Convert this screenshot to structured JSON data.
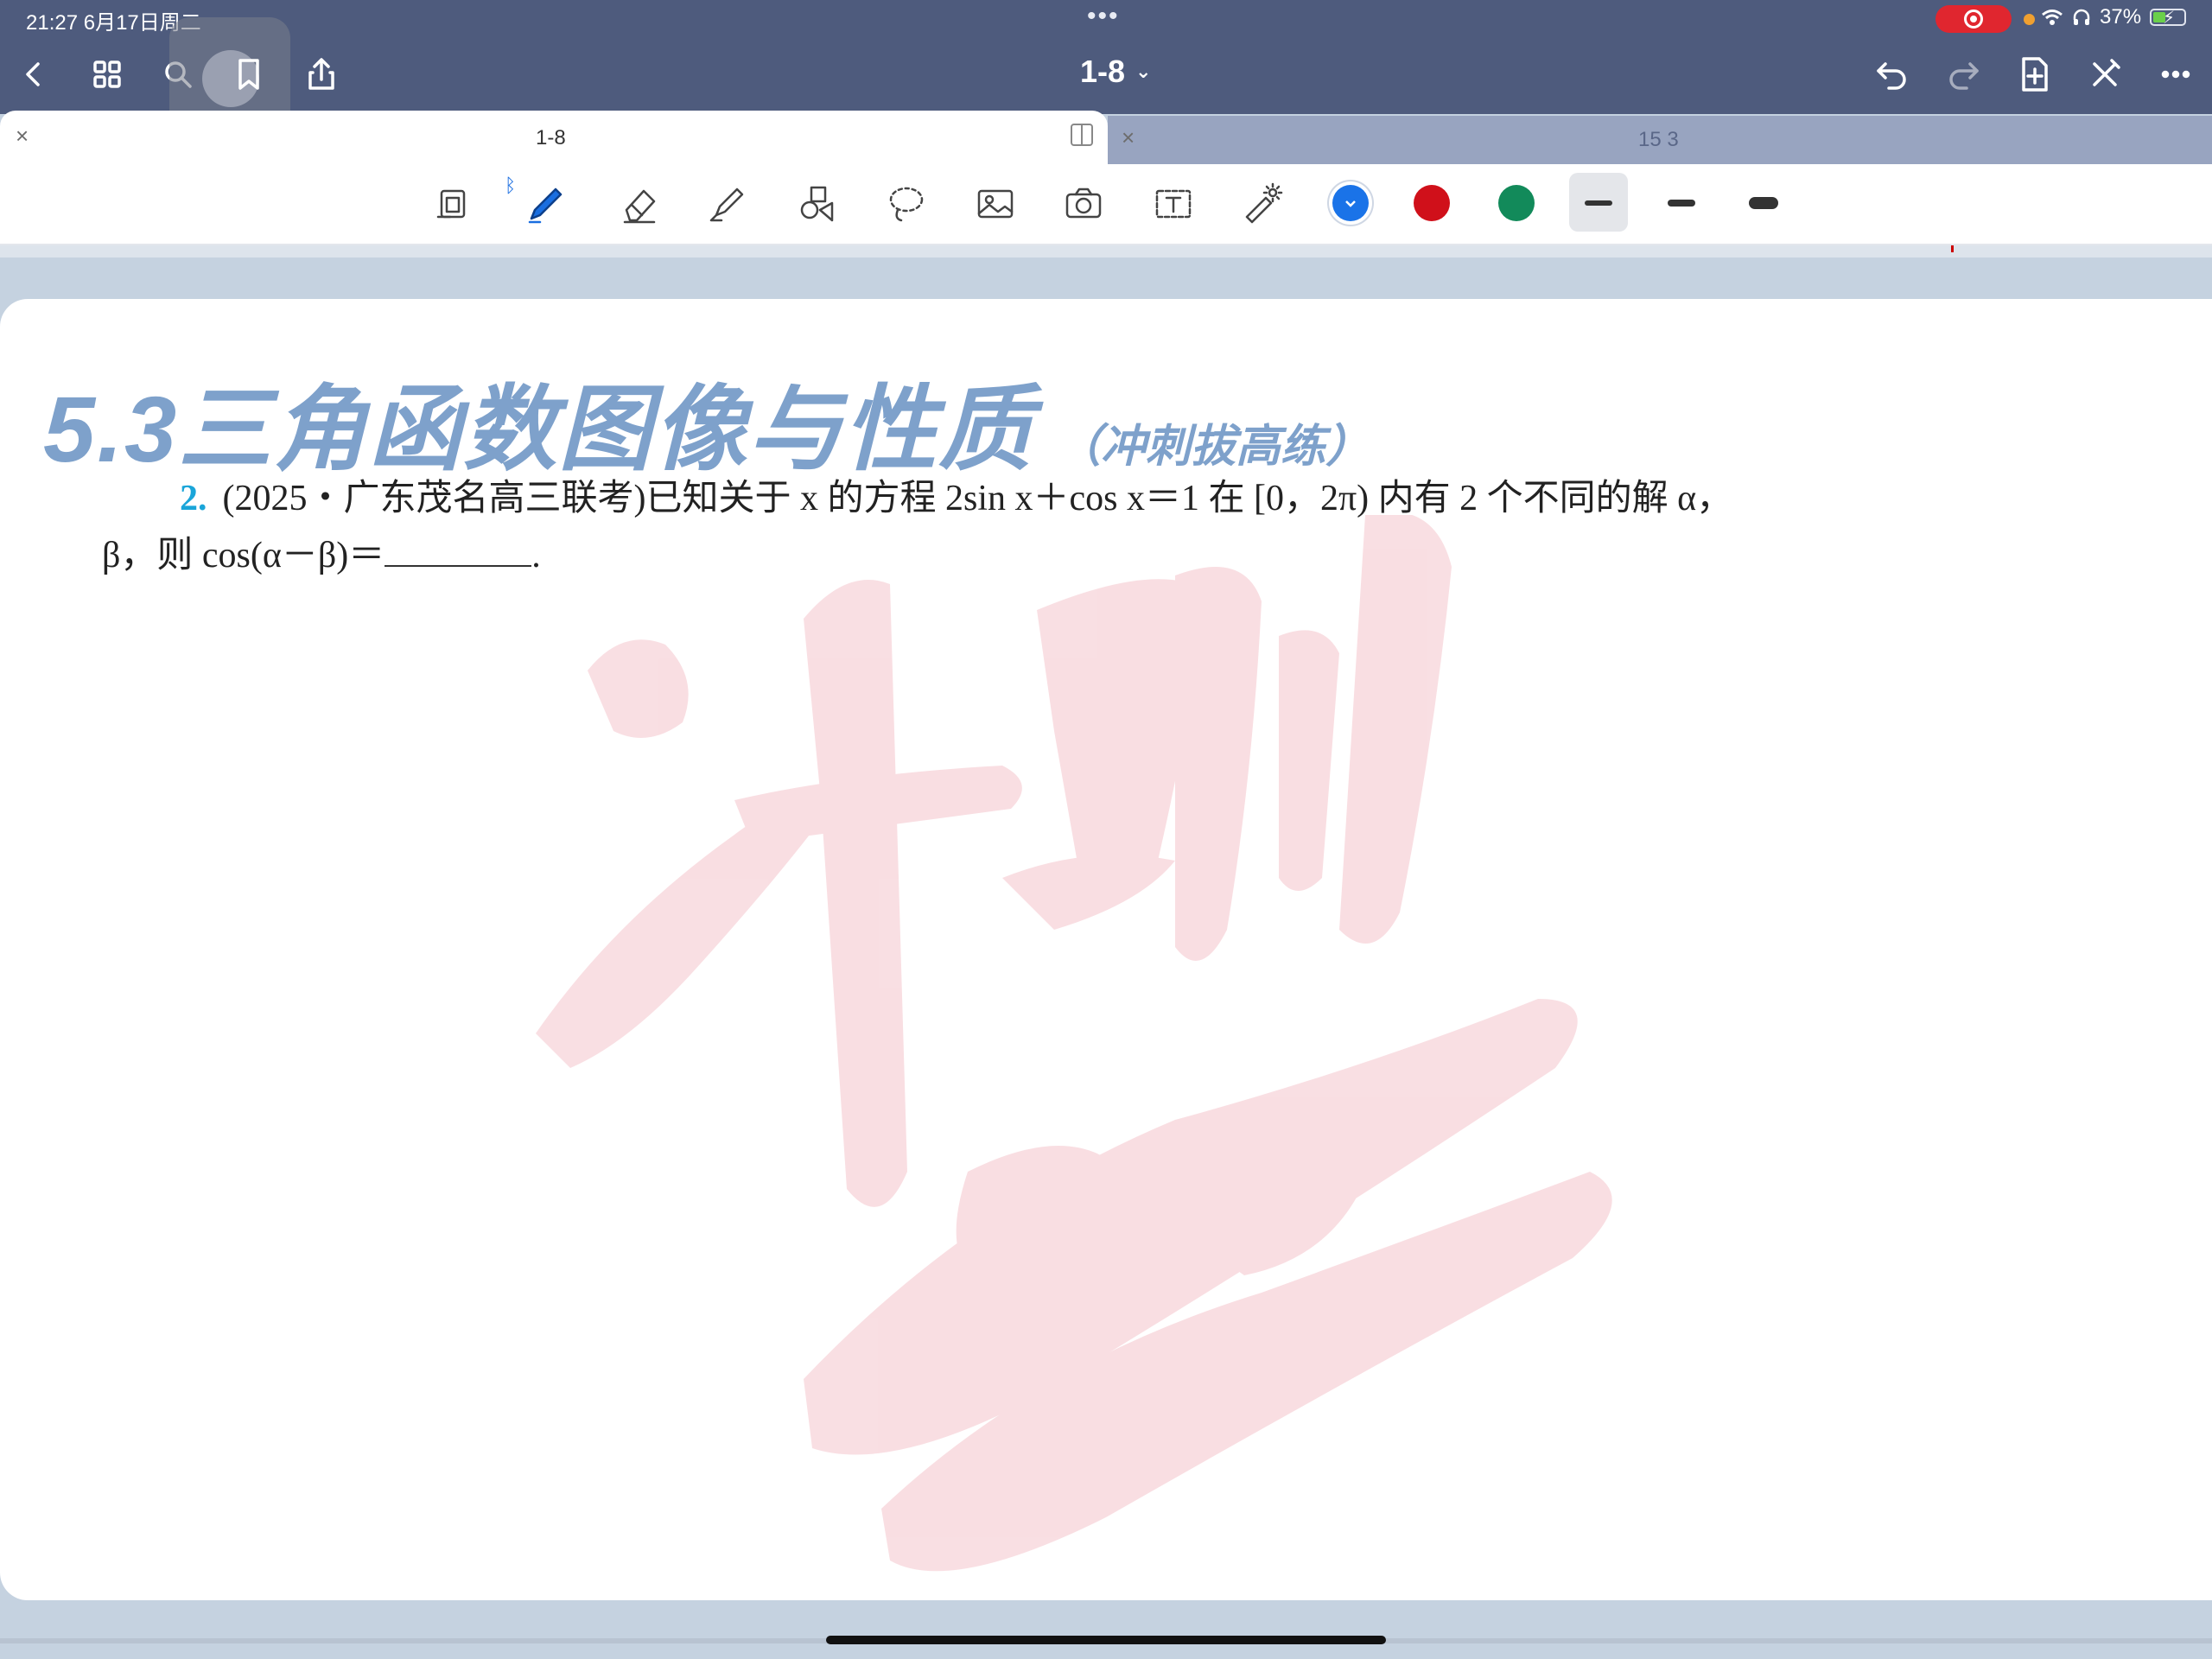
{
  "status_bar": {
    "time_date": "21:27  6月17日周二",
    "dots": "•••",
    "battery": "37%"
  },
  "nav": {
    "title": "1-8",
    "left_icons": [
      "chevron-left-icon",
      "grid-icon",
      "search-icon",
      "bookmark-icon",
      "share-icon"
    ],
    "right_icons": [
      "undo-icon",
      "redo-icon",
      "add-page-icon",
      "close-x-icon",
      "more-icon"
    ]
  },
  "tabs": [
    {
      "label": "1-8",
      "active": true
    },
    {
      "label": "15 3",
      "active": false
    }
  ],
  "toolbar": {
    "tools": [
      "read-mode-icon",
      "pen-icon",
      "eraser-icon",
      "highlighter-icon",
      "shapes-icon",
      "lasso-icon",
      "image-icon",
      "camera-icon",
      "text-box-icon",
      "laser-pointer-icon"
    ],
    "colors": [
      "#1a73e8",
      "#d0101a",
      "#128a5a"
    ],
    "selected_color": "#1a73e8",
    "stroke_widths": [
      "thin",
      "medium",
      "thick"
    ],
    "selected_width": "thin"
  },
  "page": {
    "heading_main": "5.3三角函数图像与性质",
    "heading_sub": "（冲刺拔高练）",
    "heading_color": "#7ea1cb",
    "question_number": "2.",
    "question_line1": "(2025・广东茂名高三联考)已知关于 x 的方程 2sin x＋cos x＝1 在 [0，2π) 内有 2 个不同的解 α，",
    "question_line2_before": "β，则 cos(α－β)＝",
    "question_line2_after": ".",
    "watermark_text": "冲刺"
  }
}
